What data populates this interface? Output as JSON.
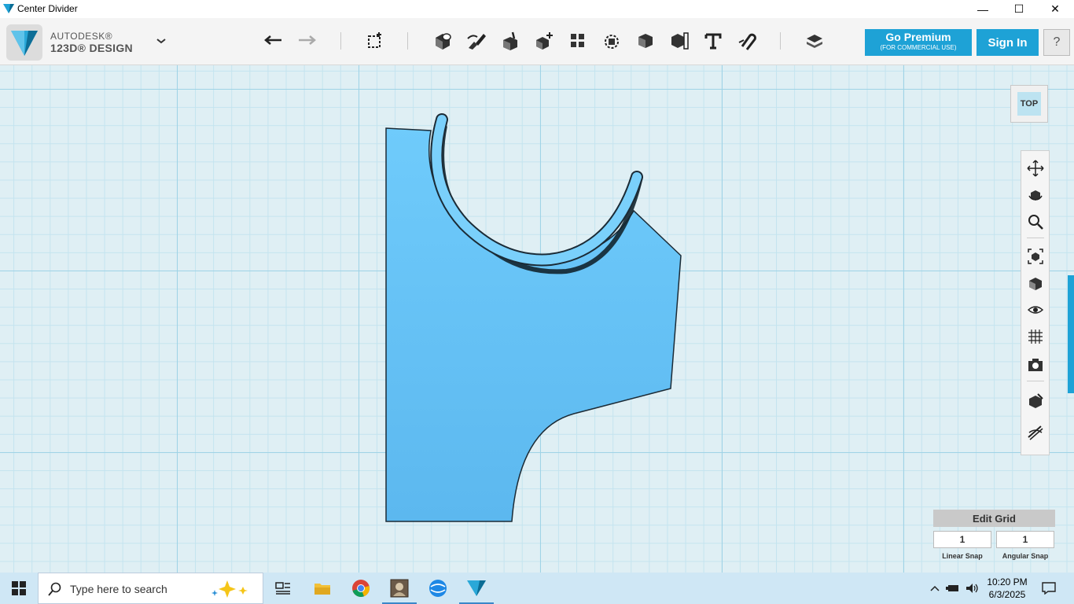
{
  "window": {
    "title": "Center Divider",
    "minimize": "—",
    "maximize": "☐",
    "close": "✕"
  },
  "brand": {
    "line1": "AUTODESK®",
    "line2": "123D® DESIGN"
  },
  "toolbar": {
    "tools": [
      "undo-icon",
      "redo-icon",
      "primitives-icon",
      "sketch-icon",
      "construct-icon",
      "modify-icon",
      "pattern-icon",
      "grouping-icon",
      "combine-icon",
      "measure-icon",
      "text-icon",
      "snap-icon",
      "material-icon"
    ]
  },
  "premium": {
    "label": "Go Premium",
    "sublabel": "(FOR COMMERCIAL USE)"
  },
  "signin": {
    "label": "Sign In"
  },
  "help": {
    "label": "?"
  },
  "viewcube": {
    "face": "TOP"
  },
  "grid": {
    "title": "Edit Grid",
    "linear_snap_value": "1",
    "linear_snap_label": "Linear Snap",
    "angular_snap_value": "1",
    "angular_snap_label": "Angular Snap"
  },
  "taskbar": {
    "search_placeholder": "Type here to search",
    "time": "10:20 PM",
    "date": "6/3/2025"
  },
  "colors": {
    "accent": "#1ea2d6",
    "shape": "#66c2f5"
  }
}
